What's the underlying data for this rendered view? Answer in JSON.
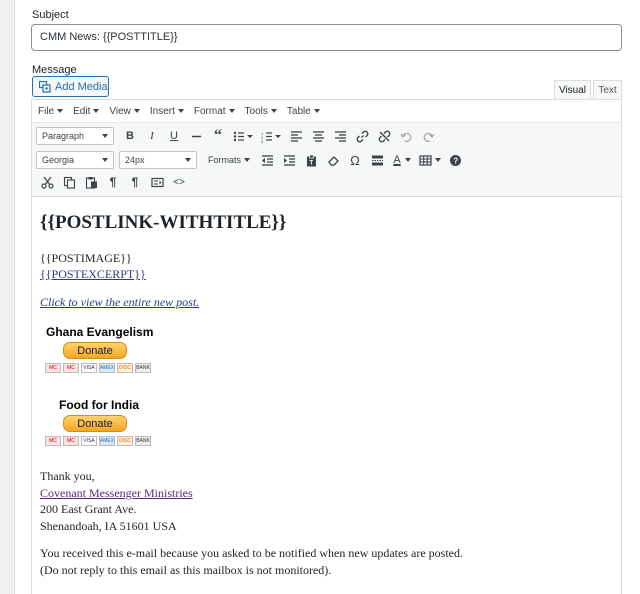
{
  "subject": {
    "label": "Subject",
    "value": "CMM News: {{POSTTITLE}}"
  },
  "message": {
    "label": "Message"
  },
  "add_media": {
    "label": "Add Media"
  },
  "tabs": {
    "visual": "Visual",
    "text": "Text"
  },
  "menu": [
    "File",
    "Edit",
    "View",
    "Insert",
    "Format",
    "Tools",
    "Table"
  ],
  "toolbar": {
    "paragraph": "Paragraph",
    "font": "Georgia",
    "size": "24px",
    "formats": "Formats",
    "bold": "B",
    "italic": "I",
    "underline": "U",
    "quote": "“",
    "omega": "Ω",
    "textcolor": "A",
    "pilcrow": "¶",
    "code": "<>"
  },
  "body": {
    "heading": "{{POSTLINK-WITHTITLE}}",
    "postimage": "{{POSTIMAGE}}",
    "postexcerpt": "{{POSTEXCERPT}}",
    "view_link": "Click to view the entire new post.",
    "donations": [
      {
        "title": "Ghana Evangelism",
        "button": "Donate"
      },
      {
        "title": "Food for India",
        "button": "Donate"
      }
    ],
    "cards": [
      "MC",
      "MC",
      "VISA",
      "AMEX",
      "DISC",
      "BANK"
    ],
    "thanks": "Thank you,",
    "org_link": "Covenant Messenger Ministries",
    "address1": "200 East Grant Ave.",
    "address2": "Shenandoah, IA 51601 USA",
    "footer1": "You received this e-mail because you asked to be notified when new updates are posted.",
    "footer2": "(Do not reply to this email as this mailbox is not monitored)."
  },
  "colors": {
    "accent": "#2271b1",
    "donate": "#f4a623"
  }
}
